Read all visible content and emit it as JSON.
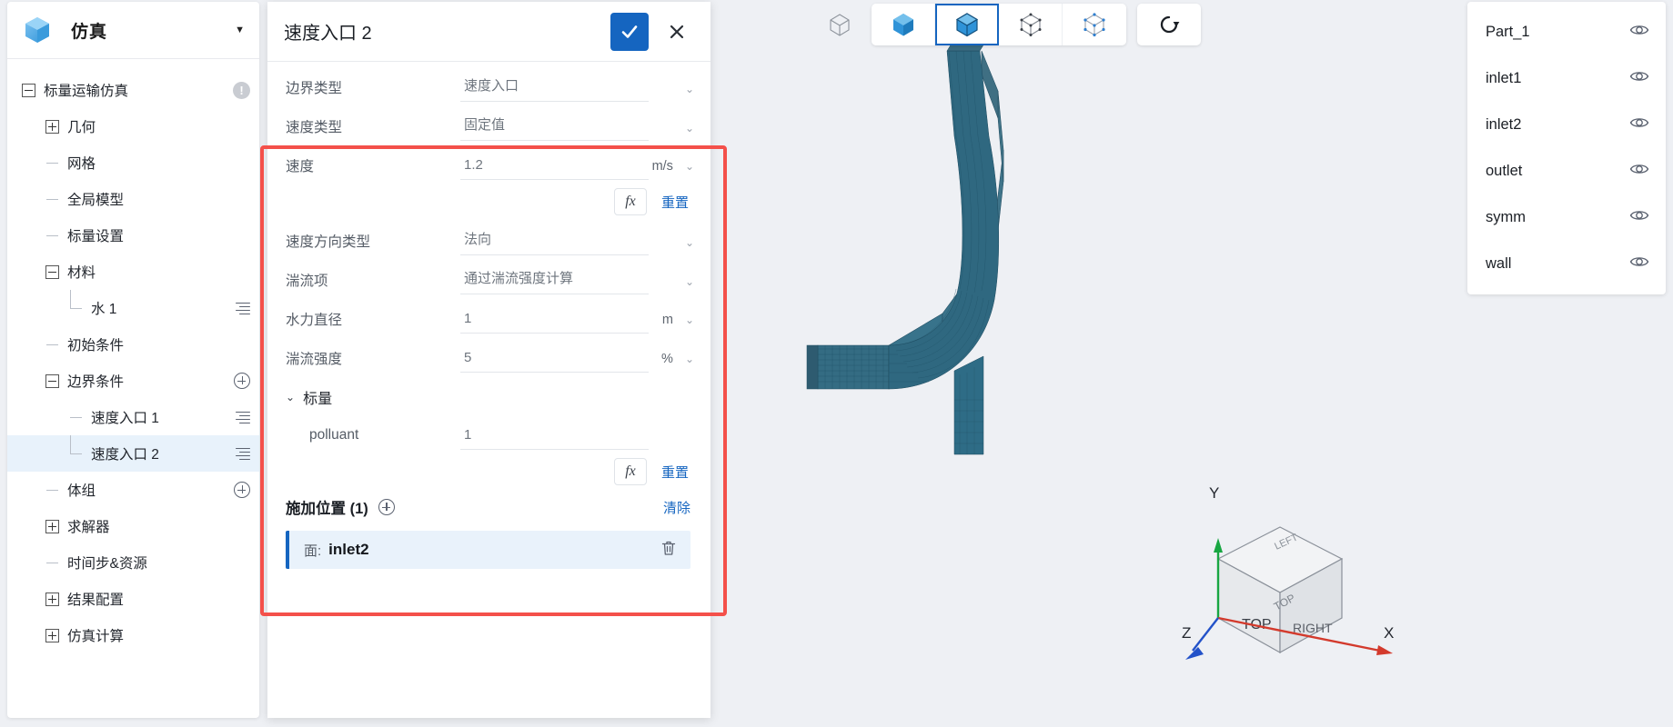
{
  "app": {
    "title": "仿真",
    "logo_icon": "cube-logo-icon",
    "caret_icon": "chevron-down-icon"
  },
  "sidebar": {
    "tree": [
      {
        "label": "标量运输仿真",
        "toggle": "minus",
        "depth": 0,
        "trail": "warn"
      },
      {
        "label": "几何",
        "toggle": "plus",
        "depth": 1,
        "trail": ""
      },
      {
        "label": "网格",
        "toggle": "leaf",
        "depth": 1,
        "trail": ""
      },
      {
        "label": "全局模型",
        "toggle": "leaf",
        "depth": 1,
        "trail": ""
      },
      {
        "label": "标量设置",
        "toggle": "leaf",
        "depth": 1,
        "trail": ""
      },
      {
        "label": "材料",
        "toggle": "minus",
        "depth": 1,
        "trail": ""
      },
      {
        "label": "水 1",
        "toggle": "leafend",
        "depth": 2,
        "trail": "menu"
      },
      {
        "label": "初始条件",
        "toggle": "leaf",
        "depth": 1,
        "trail": ""
      },
      {
        "label": "边界条件",
        "toggle": "minus",
        "depth": 1,
        "trail": "plus"
      },
      {
        "label": "速度入口 1",
        "toggle": "leaf",
        "depth": 2,
        "trail": "menu"
      },
      {
        "label": "速度入口 2",
        "toggle": "leafend",
        "depth": 2,
        "trail": "menu",
        "selected": true
      },
      {
        "label": "体组",
        "toggle": "leaf",
        "depth": 1,
        "trail": "plus"
      },
      {
        "label": "求解器",
        "toggle": "plus",
        "depth": 1,
        "trail": ""
      },
      {
        "label": "时间步&资源",
        "toggle": "leaf",
        "depth": 1,
        "trail": ""
      },
      {
        "label": "结果配置",
        "toggle": "plus",
        "depth": 1,
        "trail": ""
      },
      {
        "label": "仿真计算",
        "toggle": "plus",
        "depth": 1,
        "trail": ""
      }
    ]
  },
  "dialog": {
    "title": "速度入口 2",
    "confirm_icon": "check-icon",
    "cancel_icon": "close-icon",
    "fields": [
      {
        "label": "边界类型",
        "value": "速度入口",
        "kind": "select",
        "unit": ""
      },
      {
        "label": "速度类型",
        "value": "固定值",
        "kind": "select",
        "unit": ""
      },
      {
        "label": "速度",
        "value": "1.2",
        "kind": "input",
        "unit": "m/s"
      },
      {
        "label": "速度方向类型",
        "value": "法向",
        "kind": "select",
        "unit": ""
      },
      {
        "label": "湍流项",
        "value": "通过湍流强度计算",
        "kind": "select",
        "unit": ""
      },
      {
        "label": "水力直径",
        "value": "1",
        "kind": "input",
        "unit": "m"
      },
      {
        "label": "湍流强度",
        "value": "5",
        "kind": "input",
        "unit": "%"
      }
    ],
    "fx_label": "fx",
    "reset_label": "重置",
    "scalar_section": {
      "title": "标量",
      "caret_icon": "chevron-down-icon",
      "rows": [
        {
          "label": "polluant",
          "value": "1"
        }
      ]
    },
    "apply_location": {
      "title": "施加位置 (1)",
      "add_icon": "plus-circle-icon",
      "clear_label": "清除",
      "items": [
        {
          "kind_label": "面:",
          "name": "inlet2",
          "delete_icon": "trash-icon"
        }
      ]
    }
  },
  "viewport_toolbar": {
    "buttons": [
      {
        "name": "wireframe-view",
        "icon": "cube-wire-icon",
        "active": false,
        "grouped": false
      },
      {
        "name": "shaded-view",
        "icon": "cube-solid-icon",
        "active": false,
        "grouped": true
      },
      {
        "name": "shaded-edges-view",
        "icon": "cube-edges-icon",
        "active": true,
        "grouped": true
      },
      {
        "name": "points-view",
        "icon": "cube-points-icon",
        "active": false,
        "grouped": true
      },
      {
        "name": "vertices-view",
        "icon": "cube-vertex-icon",
        "active": false,
        "grouped": true
      },
      {
        "name": "reset-view",
        "icon": "refresh-icon",
        "active": false,
        "grouped": false
      }
    ]
  },
  "part_list": {
    "items": [
      {
        "name": "Part_1",
        "eye_icon": "eye-icon"
      },
      {
        "name": "inlet1",
        "eye_icon": "eye-icon"
      },
      {
        "name": "inlet2",
        "eye_icon": "eye-icon"
      },
      {
        "name": "outlet",
        "eye_icon": "eye-icon"
      },
      {
        "name": "symm",
        "eye_icon": "eye-icon"
      },
      {
        "name": "wall",
        "eye_icon": "eye-icon"
      }
    ]
  },
  "axis_widget": {
    "x_label": "X",
    "y_label": "Y",
    "z_label": "Z",
    "face_top": "TOP",
    "face_right": "RIGHT",
    "face_left": "LEFT",
    "face_front": "TOP"
  },
  "colors": {
    "accent": "#1565c0",
    "highlight_box": "#f4504a",
    "selection_bg": "#e8f2fb",
    "mesh": "#2c6179"
  }
}
